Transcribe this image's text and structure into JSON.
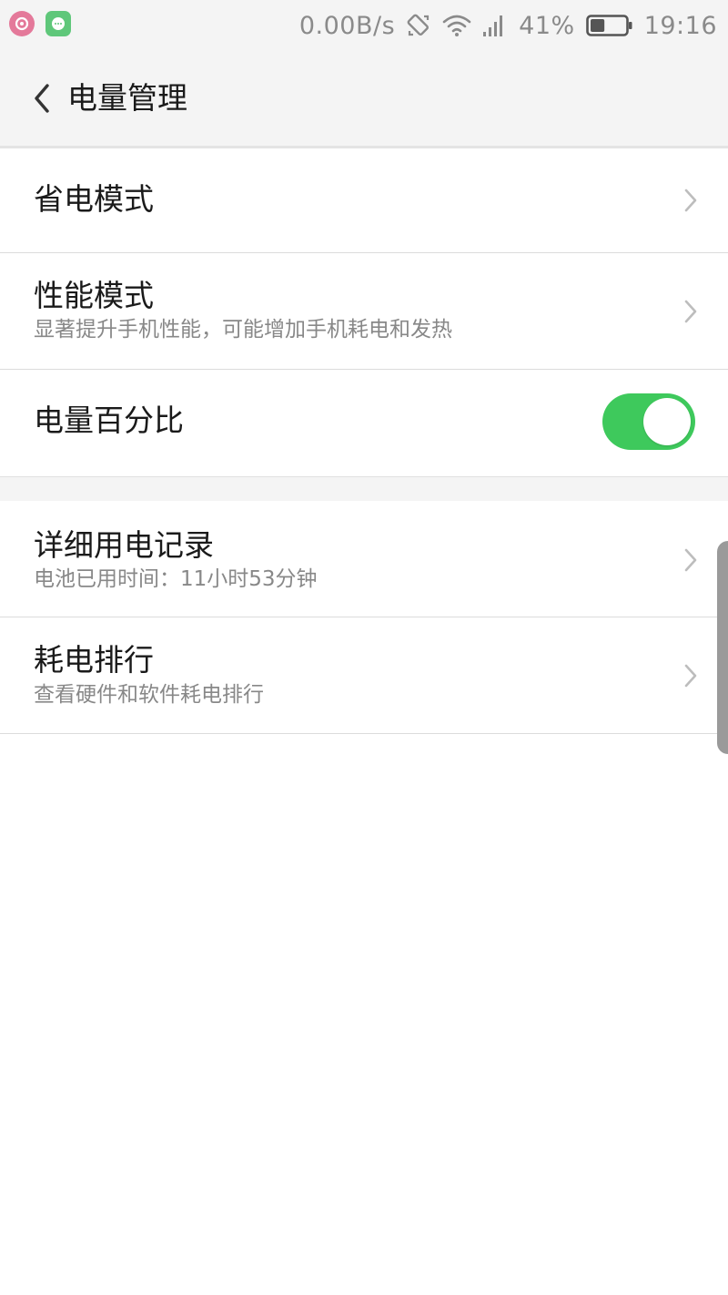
{
  "status_bar": {
    "network_speed": "0.00B/s",
    "battery_percent": "41%",
    "battery_level": 0.41,
    "time": "19:16",
    "left_icons": [
      "music-app-icon",
      "message-app-icon"
    ],
    "right_icons": [
      "rotation-lock-icon",
      "wifi-icon",
      "cellular-signal-icon",
      "battery-icon"
    ]
  },
  "header": {
    "title": "电量管理",
    "back_icon": "chevron-left-icon"
  },
  "settings": {
    "power_saving": {
      "title": "省电模式"
    },
    "performance": {
      "title": "性能模式",
      "subtitle": "显著提升手机性能，可能增加手机耗电和发热"
    },
    "battery_percentage": {
      "title": "电量百分比",
      "enabled": true
    },
    "usage_record": {
      "title": "详细用电记录",
      "subtitle": "电池已用时间：11小时53分钟"
    },
    "power_ranking": {
      "title": "耗电排行",
      "subtitle": "查看硬件和软件耗电排行"
    }
  },
  "colors": {
    "toggle_on": "#3ec95c",
    "header_bg": "#f4f4f4",
    "subtitle_text": "#888888"
  }
}
